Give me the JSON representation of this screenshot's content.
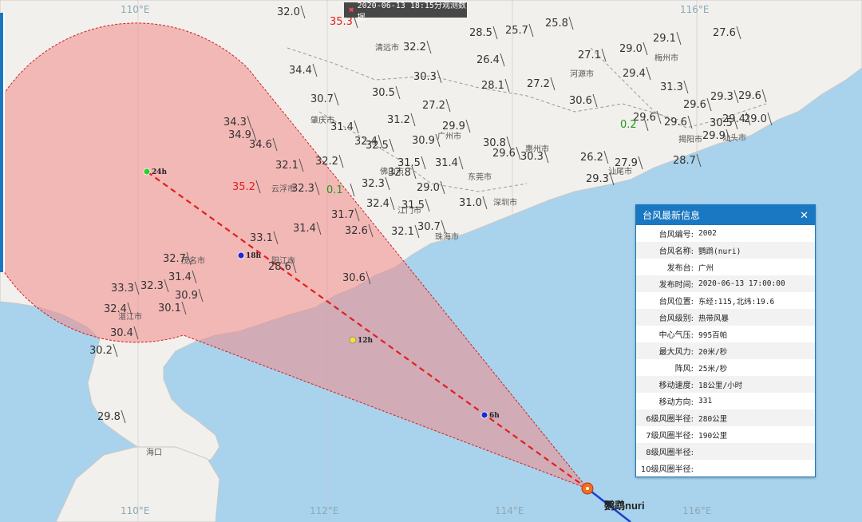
{
  "topbar": {
    "text": "2020-06-13 18:15分观测数据"
  },
  "grid_labels": [
    "110°E",
    "112°E",
    "114°E",
    "116°E"
  ],
  "observations": [
    {
      "v": "32.0",
      "c": ""
    },
    {
      "v": "35.3",
      "c": "hot"
    },
    {
      "v": "32.2",
      "c": ""
    },
    {
      "v": "28.5",
      "c": ""
    },
    {
      "v": "25.7",
      "c": ""
    },
    {
      "v": "25.8",
      "c": ""
    },
    {
      "v": "29.1",
      "c": ""
    },
    {
      "v": "27.6",
      "c": ""
    },
    {
      "v": "34.4",
      "c": ""
    },
    {
      "v": "26.4",
      "c": ""
    },
    {
      "v": "27.1",
      "c": ""
    },
    {
      "v": "29.0",
      "c": ""
    },
    {
      "v": "30.3",
      "c": ""
    },
    {
      "v": "29.4",
      "c": ""
    },
    {
      "v": "30.5",
      "c": ""
    },
    {
      "v": "28.1",
      "c": ""
    },
    {
      "v": "27.2",
      "c": ""
    },
    {
      "v": "30.6",
      "c": ""
    },
    {
      "v": "31.3",
      "c": ""
    },
    {
      "v": "30.7",
      "c": ""
    },
    {
      "v": "27.2",
      "c": ""
    },
    {
      "v": "29.6",
      "c": ""
    },
    {
      "v": "29.3",
      "c": ""
    },
    {
      "v": "29.6",
      "c": ""
    },
    {
      "v": "31.2",
      "c": ""
    },
    {
      "v": "29.6",
      "c": ""
    },
    {
      "v": "29.6",
      "c": ""
    },
    {
      "v": "30.5",
      "c": ""
    },
    {
      "v": "29.4",
      "c": ""
    },
    {
      "v": "29.0",
      "c": ""
    },
    {
      "v": "0.2",
      "c": "low"
    },
    {
      "v": "31.4",
      "c": ""
    },
    {
      "v": "29.9",
      "c": ""
    },
    {
      "v": "34.3",
      "c": ""
    },
    {
      "v": "34.9",
      "c": ""
    },
    {
      "v": "32.4",
      "c": ""
    },
    {
      "v": "32.5",
      "c": ""
    },
    {
      "v": "30.9",
      "c": ""
    },
    {
      "v": "30.8",
      "c": ""
    },
    {
      "v": "29.9",
      "c": ""
    },
    {
      "v": "34.6",
      "c": ""
    },
    {
      "v": "29.6",
      "c": ""
    },
    {
      "v": "30.3",
      "c": ""
    },
    {
      "v": "32.2",
      "c": ""
    },
    {
      "v": "31.5",
      "c": ""
    },
    {
      "v": "31.4",
      "c": ""
    },
    {
      "v": "26.2",
      "c": ""
    },
    {
      "v": "27.9",
      "c": ""
    },
    {
      "v": "28.7",
      "c": ""
    },
    {
      "v": "32.1",
      "c": ""
    },
    {
      "v": "32.8",
      "c": ""
    },
    {
      "v": "29.3",
      "c": ""
    },
    {
      "v": "35.2",
      "c": "hot"
    },
    {
      "v": "32.3",
      "c": ""
    },
    {
      "v": "0.1",
      "c": "low"
    },
    {
      "v": "32.3",
      "c": ""
    },
    {
      "v": "29.0",
      "c": ""
    },
    {
      "v": "32.4",
      "c": ""
    },
    {
      "v": "31.5",
      "c": ""
    },
    {
      "v": "31.0",
      "c": ""
    },
    {
      "v": "31.7",
      "c": ""
    },
    {
      "v": "31.4",
      "c": ""
    },
    {
      "v": "32.6",
      "c": ""
    },
    {
      "v": "30.7",
      "c": ""
    },
    {
      "v": "32.1",
      "c": ""
    },
    {
      "v": "33.1",
      "c": ""
    },
    {
      "v": "32.7",
      "c": ""
    },
    {
      "v": "28.6",
      "c": ""
    },
    {
      "v": "31.4",
      "c": ""
    },
    {
      "v": "30.6",
      "c": ""
    },
    {
      "v": "33.3",
      "c": ""
    },
    {
      "v": "32.3",
      "c": ""
    },
    {
      "v": "30.9",
      "c": ""
    },
    {
      "v": "32.4",
      "c": ""
    },
    {
      "v": "30.1",
      "c": ""
    },
    {
      "v": "30.4",
      "c": ""
    },
    {
      "v": "30.2",
      "c": ""
    },
    {
      "v": "29.8",
      "c": ""
    }
  ],
  "cities": [
    "清远市",
    "梅州市",
    "河源市",
    "肇庆市",
    "广州市",
    "惠州市",
    "揭阳市",
    "汕头市",
    "佛山市",
    "东莞市",
    "汕尾市",
    "云浮市",
    "深圳市",
    "江门市",
    "珠海市",
    "茂名市",
    "阳江市",
    "湛江市",
    "海口"
  ],
  "forecast": [
    "24h",
    "18h",
    "12h",
    "6h"
  ],
  "typhoon_name": "鹦鹉nuri",
  "panel": {
    "title": "台风最新信息",
    "rows": [
      {
        "k": "台风编号:",
        "v": "2002"
      },
      {
        "k": "台风名称:",
        "v": "鹦鹉(nuri)"
      },
      {
        "k": "发布台:",
        "v": "广州"
      },
      {
        "k": "发布时间:",
        "v": "2020-06-13 17:00:00"
      },
      {
        "k": "台风位置:",
        "v": "东经:115,北纬:19.6"
      },
      {
        "k": "台风级别:",
        "v": "热带风暴"
      },
      {
        "k": "中心气压:",
        "v": "995百帕"
      },
      {
        "k": "最大风力:",
        "v": "20米/秒"
      },
      {
        "k": "阵风:",
        "v": "25米/秒"
      },
      {
        "k": "移动速度:",
        "v": "18公里/小时"
      },
      {
        "k": "移动方向:",
        "v": "331"
      },
      {
        "k": "6级风圈半径:",
        "v": "280公里"
      },
      {
        "k": "7级风圈半径:",
        "v": "190公里"
      },
      {
        "k": "8级风圈半径:",
        "v": ""
      },
      {
        "k": "10级风圈半径:",
        "v": ""
      }
    ]
  },
  "colors": {
    "sea": "#a9d3ec",
    "land": "#f2f0ec",
    "cone": "#f28a8a",
    "track": "#e02020",
    "panel": "#1a78c2"
  }
}
